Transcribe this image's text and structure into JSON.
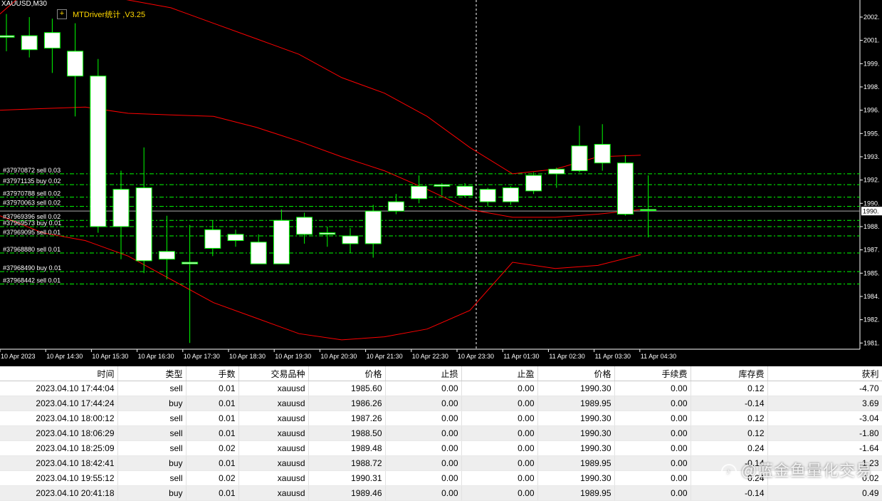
{
  "chart": {
    "symbol": "XAUUSD,M30",
    "indicator_name": "MTDriver统计 ,V3.25",
    "indicator_icon": "plus-icon",
    "current_price": "1990.",
    "colors": {
      "background": "#000000",
      "bull": "#ffffff",
      "bear": "#ffffff",
      "wick": "#00ff00",
      "band": "#ff0000",
      "levels": "#00ff00"
    },
    "y_ticks": [
      "2002.",
      "2001.",
      "1999.",
      "1998.",
      "1996.",
      "1995.",
      "1993.",
      "1992.",
      "1990.",
      "1988.",
      "1987.",
      "1985.",
      "1984.",
      "1982.",
      "1981."
    ],
    "x_ticks": [
      "10 Apr 2023",
      "10 Apr 14:30",
      "10 Apr 15:30",
      "10 Apr 16:30",
      "10 Apr 17:30",
      "10 Apr 18:30",
      "10 Apr 19:30",
      "10 Apr 20:30",
      "10 Apr 21:30",
      "10 Apr 22:30",
      "10 Apr 23:30",
      "11 Apr 01:30",
      "11 Apr 02:30",
      "11 Apr 03:30",
      "11 Apr 04:30"
    ],
    "order_labels": [
      "#37970872 sell 0.03",
      "#37971135 buy 0.02",
      "#37970788 sell 0.02",
      "#37970063 sell 0.02",
      "#37969396 sell 0.02",
      "#37969573 buy 0.01",
      "#37969095 sell 0.01",
      "#37968880 sell 0.01",
      "#37968490 buy 0.01",
      "#37968442 sell 0.01"
    ]
  },
  "chart_data": {
    "type": "candlestick",
    "title": "XAUUSD,M30",
    "ylim": [
      1981.0,
      2003.5
    ],
    "candles": [
      {
        "o": 2001.2,
        "h": 2002.6,
        "l": 2000.2,
        "c": 2001.1
      },
      {
        "o": 2001.2,
        "h": 2002.4,
        "l": 1999.8,
        "c": 2000.3
      },
      {
        "o": 2000.4,
        "h": 2002.3,
        "l": 1998.8,
        "c": 2001.4
      },
      {
        "o": 2000.2,
        "h": 2002.0,
        "l": 1996.0,
        "c": 1998.6
      },
      {
        "o": 1998.6,
        "h": 1999.7,
        "l": 1988.5,
        "c": 1988.9
      },
      {
        "o": 1991.3,
        "h": 1992.5,
        "l": 1986.8,
        "c": 1988.9
      },
      {
        "o": 1991.4,
        "h": 1994.0,
        "l": 1985.9,
        "c": 1986.7
      },
      {
        "o": 1987.3,
        "h": 1989.6,
        "l": 1985.5,
        "c": 1986.8
      },
      {
        "o": 1986.5,
        "h": 1989.0,
        "l": 1981.4,
        "c": 1986.6
      },
      {
        "o": 1987.5,
        "h": 1989.3,
        "l": 1987.0,
        "c": 1988.7
      },
      {
        "o": 1988.4,
        "h": 1988.7,
        "l": 1987.6,
        "c": 1988.0
      },
      {
        "o": 1987.9,
        "h": 1988.4,
        "l": 1986.8,
        "c": 1986.5
      },
      {
        "o": 1986.5,
        "h": 1990.0,
        "l": 1986.6,
        "c": 1989.3
      },
      {
        "o": 1989.5,
        "h": 1989.8,
        "l": 1987.8,
        "c": 1988.4
      },
      {
        "o": 1988.5,
        "h": 1988.9,
        "l": 1987.6,
        "c": 1988.4
      },
      {
        "o": 1988.3,
        "h": 1988.8,
        "l": 1987.2,
        "c": 1987.8
      },
      {
        "o": 1987.8,
        "h": 1990.3,
        "l": 1986.9,
        "c": 1989.9
      },
      {
        "o": 1989.9,
        "h": 1991.0,
        "l": 1989.7,
        "c": 1990.5
      },
      {
        "o": 1990.7,
        "h": 1992.2,
        "l": 1990.4,
        "c": 1991.5
      },
      {
        "o": 1991.6,
        "h": 1991.7,
        "l": 1990.9,
        "c": 1991.5
      },
      {
        "o": 1991.5,
        "h": 1991.7,
        "l": 1990.8,
        "c": 1990.9
      },
      {
        "o": 1990.5,
        "h": 1991.4,
        "l": 1990.2,
        "c": 1991.3
      },
      {
        "o": 1990.5,
        "h": 1991.5,
        "l": 1990.3,
        "c": 1991.4
      },
      {
        "o": 1991.2,
        "h": 1992.4,
        "l": 1991.0,
        "c": 1992.2
      },
      {
        "o": 1992.3,
        "h": 1992.7,
        "l": 1991.4,
        "c": 1992.6
      },
      {
        "o": 1992.5,
        "h": 1995.4,
        "l": 1992.4,
        "c": 1994.1
      },
      {
        "o": 1994.2,
        "h": 1995.5,
        "l": 1992.5,
        "c": 1993.0
      },
      {
        "o": 1993.0,
        "h": 1993.5,
        "l": 1989.6,
        "c": 1989.7
      },
      {
        "o": 1990.0,
        "h": 1992.2,
        "l": 1988.2,
        "c": 1990.0
      }
    ],
    "bands": {
      "upper": [
        2002.6,
        2005.0,
        2004.0,
        2003.5,
        2003.0,
        2002.0,
        2001.0,
        2000.0,
        1998.5,
        1997.5,
        1996.0,
        1994.0,
        1992.3,
        1992.6,
        1993.4,
        1993.5
      ],
      "middle": [
        1996.4,
        1996.5,
        1996.6,
        1996.2,
        1996.1,
        1996.0,
        1995.3,
        1994.4,
        1993.4,
        1992.5,
        1991.3,
        1990.0,
        1989.5,
        1989.5,
        1989.7,
        1990.0
      ],
      "lower": [
        1989.6,
        1988.5,
        1988.0,
        1987.0,
        1985.5,
        1984.0,
        1983.0,
        1982.0,
        1981.6,
        1981.8,
        1982.3,
        1983.5,
        1986.6,
        1986.2,
        1986.4,
        1987.1
      ]
    },
    "order_levels": [
      1992.3,
      1991.6,
      1990.8,
      1990.2,
      1989.3,
      1988.9,
      1988.3,
      1987.2,
      1986.0,
      1985.2
    ],
    "vertical_marker": "10 Apr 23:30"
  },
  "table": {
    "headers": [
      "时间",
      "类型",
      "手数",
      "交易品种",
      "价格",
      "止损",
      "止盈",
      "价格",
      "手续费",
      "库存费",
      "获利"
    ],
    "rows": [
      [
        "2023.04.10 17:44:04",
        "sell",
        "0.01",
        "xauusd",
        "1985.60",
        "0.00",
        "0.00",
        "1990.30",
        "0.00",
        "0.12",
        "-4.70"
      ],
      [
        "2023.04.10 17:44:24",
        "buy",
        "0.01",
        "xauusd",
        "1986.26",
        "0.00",
        "0.00",
        "1989.95",
        "0.00",
        "-0.14",
        "3.69"
      ],
      [
        "2023.04.10 18:00:12",
        "sell",
        "0.01",
        "xauusd",
        "1987.26",
        "0.00",
        "0.00",
        "1990.30",
        "0.00",
        "0.12",
        "-3.04"
      ],
      [
        "2023.04.10 18:06:29",
        "sell",
        "0.01",
        "xauusd",
        "1988.50",
        "0.00",
        "0.00",
        "1990.30",
        "0.00",
        "0.12",
        "-1.80"
      ],
      [
        "2023.04.10 18:25:09",
        "sell",
        "0.02",
        "xauusd",
        "1989.48",
        "0.00",
        "0.00",
        "1990.30",
        "0.00",
        "0.24",
        "-1.64"
      ],
      [
        "2023.04.10 18:42:41",
        "buy",
        "0.01",
        "xauusd",
        "1988.72",
        "0.00",
        "0.00",
        "1989.95",
        "0.00",
        "-0.14",
        "1.23"
      ],
      [
        "2023.04.10 19:55:12",
        "sell",
        "0.02",
        "xauusd",
        "1990.31",
        "0.00",
        "0.00",
        "1990.30",
        "0.00",
        "0.24",
        "0.02"
      ],
      [
        "2023.04.10 20:41:18",
        "buy",
        "0.01",
        "xauusd",
        "1989.46",
        "0.00",
        "0.00",
        "1989.95",
        "0.00",
        "-0.14",
        "0.49"
      ]
    ]
  },
  "watermark": "@蓝金鱼量化交易"
}
